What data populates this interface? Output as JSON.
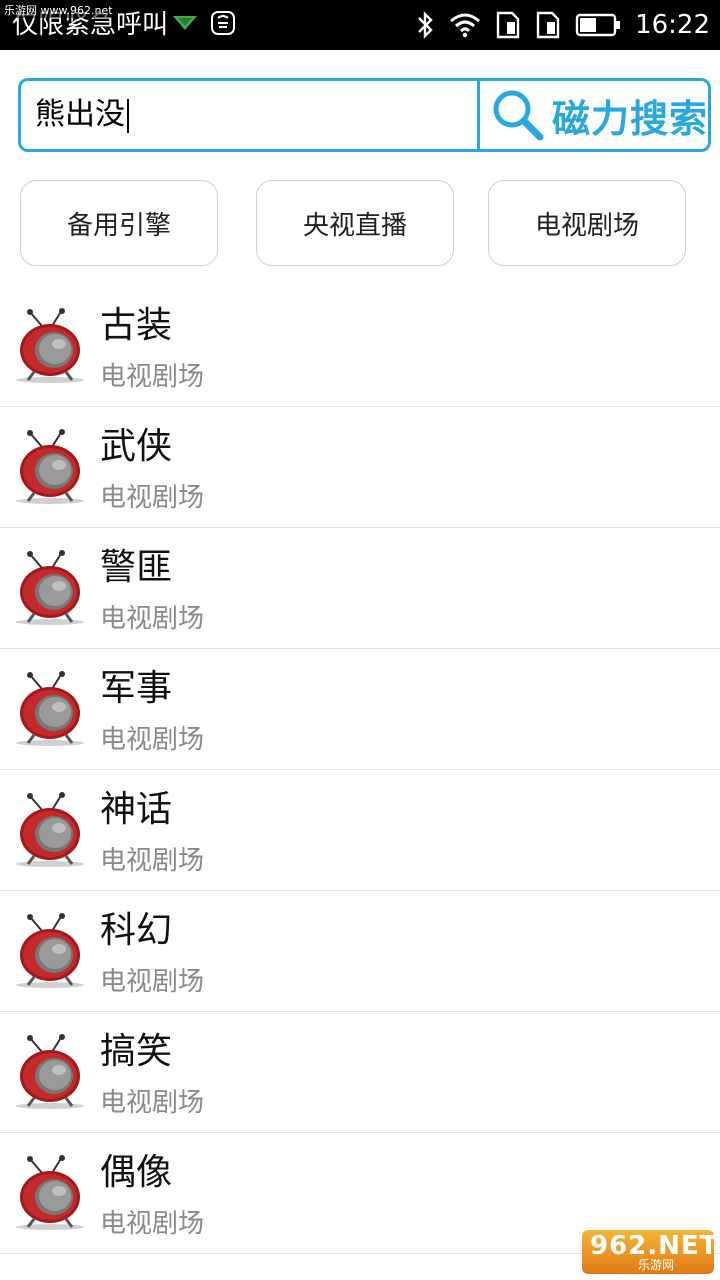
{
  "status_bar": {
    "carrier_text": "仅限紧急呼叫",
    "time": "16:22",
    "watermark": "乐游网 www.962.net",
    "icons": [
      "data-arrow-icon",
      "huawei-app-icon",
      "bluetooth-icon",
      "wifi-icon",
      "sim1-icon",
      "sim2-icon",
      "battery-icon"
    ]
  },
  "search": {
    "query": "熊出没",
    "button_label": "磁力搜索",
    "accent_color": "#29a8e0"
  },
  "tabs": [
    {
      "label": "备用引擎"
    },
    {
      "label": "央视直播"
    },
    {
      "label": "电视剧场"
    }
  ],
  "list": [
    {
      "title": "古装",
      "subtitle": "电视剧场",
      "icon": "retro-tv-icon"
    },
    {
      "title": "武侠",
      "subtitle": "电视剧场",
      "icon": "retro-tv-icon"
    },
    {
      "title": "警匪",
      "subtitle": "电视剧场",
      "icon": "retro-tv-icon"
    },
    {
      "title": "军事",
      "subtitle": "电视剧场",
      "icon": "retro-tv-icon"
    },
    {
      "title": "神话",
      "subtitle": "电视剧场",
      "icon": "retro-tv-icon"
    },
    {
      "title": "科幻",
      "subtitle": "电视剧场",
      "icon": "retro-tv-icon"
    },
    {
      "title": "搞笑",
      "subtitle": "电视剧场",
      "icon": "retro-tv-icon"
    },
    {
      "title": "偶像",
      "subtitle": "电视剧场",
      "icon": "retro-tv-icon"
    }
  ],
  "bottom_watermark": {
    "main": "962.NET",
    "sub": "乐游网"
  }
}
